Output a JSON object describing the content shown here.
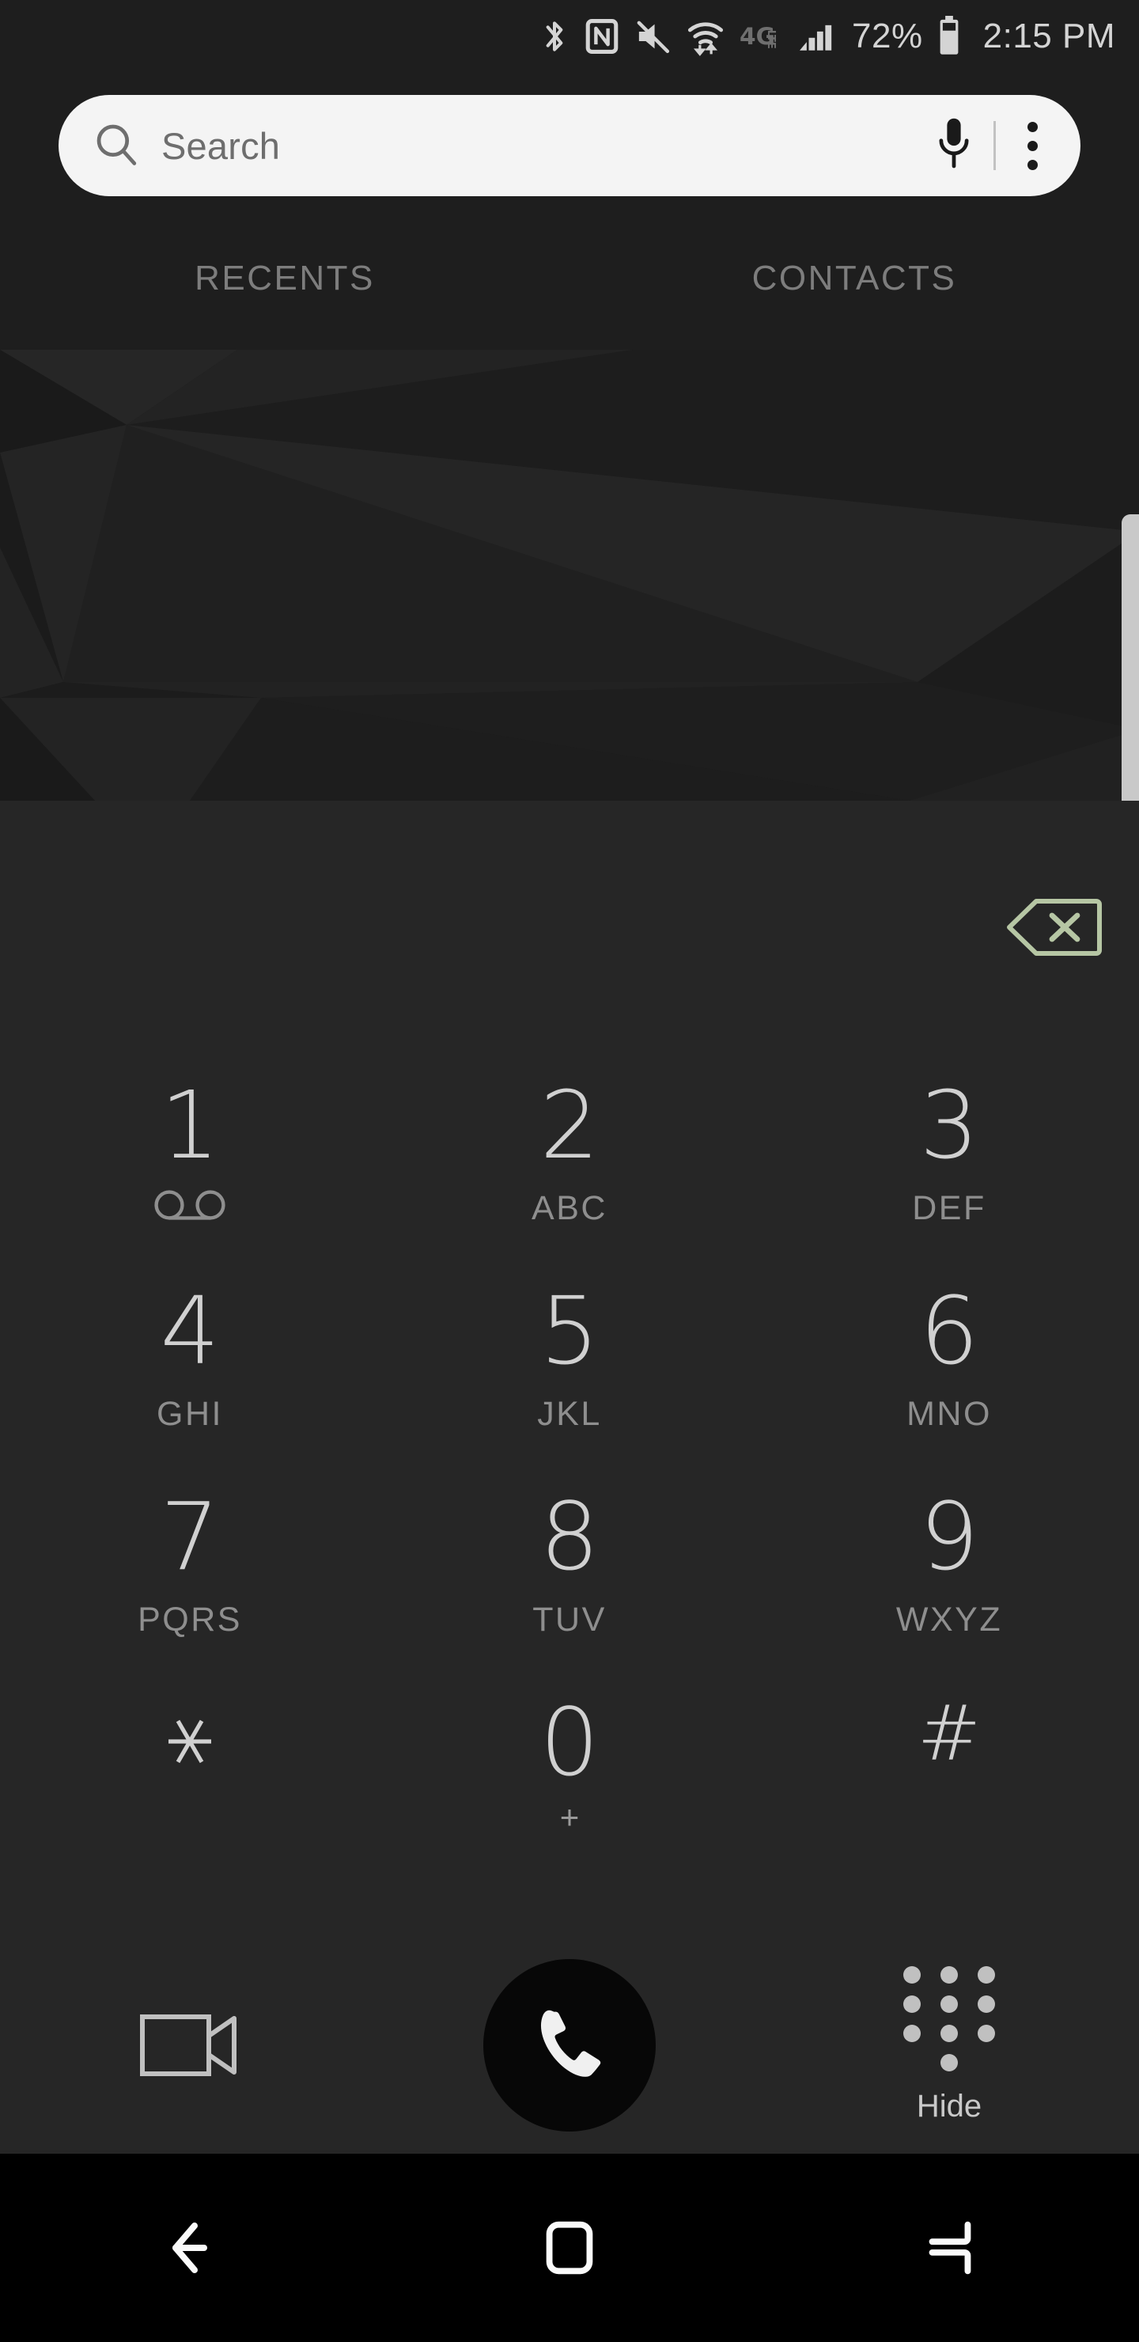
{
  "status_bar": {
    "icons": [
      {
        "name": "bluetooth-icon",
        "label": "Bluetooth"
      },
      {
        "name": "nfc-icon",
        "label": "NFC"
      },
      {
        "name": "volume-off-icon",
        "label": "Sound off"
      },
      {
        "name": "wifi-data-icon",
        "label": "Wi-Fi"
      },
      {
        "name": "network-4glte-icon",
        "label": "4G LTE"
      },
      {
        "name": "signal-bars-icon",
        "label": "Signal"
      }
    ],
    "battery_percent": "72%",
    "battery_icon": "battery-icon",
    "time": "2:15 PM"
  },
  "search": {
    "placeholder": "Search",
    "search_icon": "search-icon",
    "mic_icon": "microphone-icon",
    "overflow_icon": "overflow-menu-icon"
  },
  "tabs": [
    {
      "label": "RECENTS",
      "name": "tab-recents",
      "selected": false
    },
    {
      "label": "CONTACTS",
      "name": "tab-contacts",
      "selected": false
    }
  ],
  "dialpad": {
    "backspace_icon": "backspace-icon",
    "backspace_color": "#b6c6a4",
    "rows": [
      [
        {
          "digit": "1",
          "letters": "",
          "icon": "voicemail-icon"
        },
        {
          "digit": "2",
          "letters": "ABC",
          "icon": ""
        },
        {
          "digit": "3",
          "letters": "DEF",
          "icon": ""
        }
      ],
      [
        {
          "digit": "4",
          "letters": "GHI",
          "icon": ""
        },
        {
          "digit": "5",
          "letters": "JKL",
          "icon": ""
        },
        {
          "digit": "6",
          "letters": "MNO",
          "icon": ""
        }
      ],
      [
        {
          "digit": "7",
          "letters": "PQRS",
          "icon": ""
        },
        {
          "digit": "8",
          "letters": "TUV",
          "icon": ""
        },
        {
          "digit": "9",
          "letters": "WXYZ",
          "icon": ""
        }
      ],
      [
        {
          "digit": "✳",
          "letters": "",
          "icon": ""
        },
        {
          "digit": "0",
          "letters": "+",
          "icon": ""
        },
        {
          "digit": "#",
          "letters": "",
          "icon": ""
        }
      ]
    ]
  },
  "actions": {
    "video_call_icon": "video-call-icon",
    "call_icon": "phone-call-icon",
    "call_button_color": "#070707",
    "hide_icon": "keypad-dots-icon",
    "hide_label": "Hide"
  },
  "nav_bar": {
    "back_icon": "back-arrow-icon",
    "home_icon": "home-square-icon",
    "recents_icon": "recent-apps-icon"
  },
  "colors": {
    "status_bar_bg": "#1e1e1e",
    "dial_panel_bg": "#262626",
    "nav_bar_bg": "#000000",
    "search_bar_bg": "#f4f4f4",
    "digit_color": "#d0d0d0",
    "letters_color": "#8e8e8e",
    "scrollbar_color": "#c9c9c9"
  }
}
